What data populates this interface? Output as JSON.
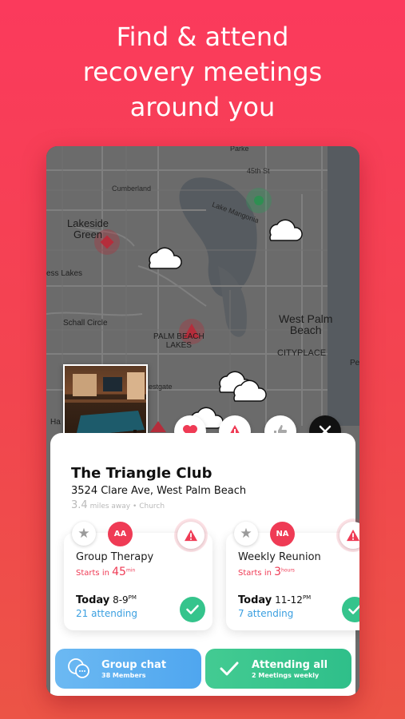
{
  "headline": {
    "line1": "Find & attend",
    "line2": "recovery meetings",
    "line3": "around you"
  },
  "map": {
    "labels": {
      "lakeside_green": "Lakeside\nGreen",
      "ess_lakes": "ess Lakes",
      "schall_circle": "Schall Circle",
      "palm_beach_lakes": "PALM BEACH\nLAKES",
      "west_palm_beach": "West Palm\nBeach",
      "cityplace": "CITYPLACE",
      "lake_mangonia": "Lake Mangonia",
      "cumberland": "Cumberland",
      "estgate": "estgate",
      "st_45": "45th St",
      "parke": "Parke",
      "pe": "Pe",
      "ha": "Ha"
    },
    "colors": {
      "map_bg": "#6b6b6b",
      "water": "#565b60",
      "road": "#7d7d7d"
    }
  },
  "actions": {
    "favorite_icon": "heart-icon",
    "report_icon": "warning-icon",
    "like_icon": "thumbs-up-icon",
    "close_icon": "close-icon"
  },
  "venue": {
    "name": "The Triangle Club",
    "address": "3524 Clare Ave, West Palm Beach",
    "distance": "3.4",
    "distance_unit": "miles away",
    "separator": "•",
    "type": "Church"
  },
  "meetings": [
    {
      "badge": "AA",
      "title": "Group Therapy",
      "starts_prefix": "Starts in",
      "starts_value": "45",
      "starts_unit": "min",
      "day": "Today",
      "time_start": "8-9",
      "time_suffix": "PM",
      "attending": "21 attending"
    },
    {
      "badge": "NA",
      "title": "Weekly Reunion",
      "starts_prefix": "Starts in",
      "starts_value": "3",
      "starts_unit": "hours",
      "day": "Today",
      "time_start": "11-12",
      "time_suffix": "PM",
      "attending": "7 attending"
    }
  ],
  "bottom": {
    "chat_title": "Group chat",
    "chat_sub": "38 Members",
    "attend_title": "Attending all",
    "attend_sub": "2 Meetings weekly"
  },
  "colors": {
    "accent": "#ef3b55",
    "blue": "#3a9fe0",
    "green": "#35c48c"
  }
}
